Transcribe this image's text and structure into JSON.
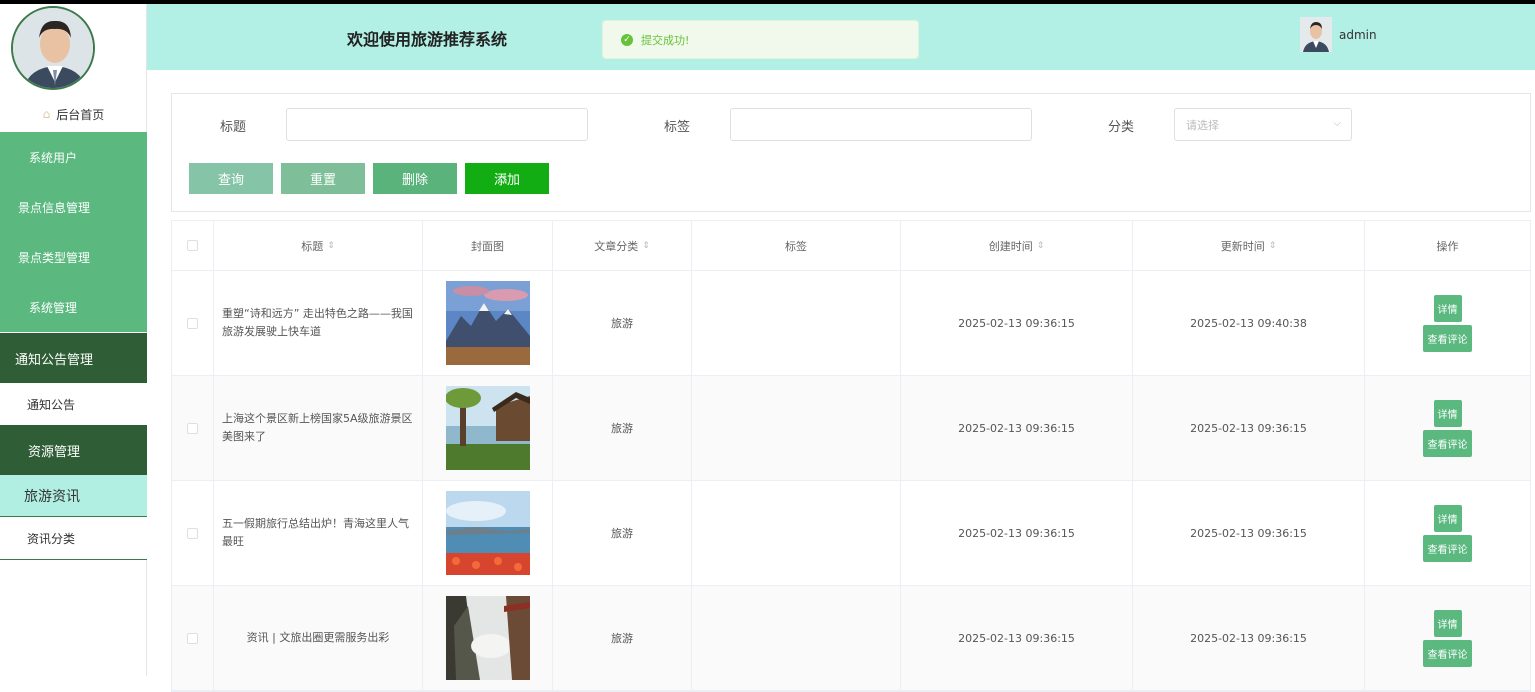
{
  "colors": {
    "sidebar_green": "#5bb980",
    "sidebar_dark": "#2f5d35",
    "header_bg": "#b2f0e5",
    "btn_query": "#85c4a6",
    "btn_reset": "#7ebf99",
    "btn_delete": "#5bb37c",
    "btn_add": "#12ad12"
  },
  "sidebar": {
    "home_label": "后台首页",
    "items": [
      {
        "label": "系统用户"
      },
      {
        "label": "景点信息管理"
      },
      {
        "label": "景点类型管理"
      },
      {
        "label": "系统管理"
      },
      {
        "label": "通知公告管理"
      },
      {
        "label": "通知公告"
      },
      {
        "label": "资源管理"
      },
      {
        "label": "旅游资讯"
      },
      {
        "label": "资讯分类"
      }
    ]
  },
  "header": {
    "title": "欢迎使用旅游推荐系统",
    "toast": "提交成功!",
    "user": "admin"
  },
  "search": {
    "title_label": "标题",
    "tag_label": "标签",
    "category_label": "分类",
    "category_placeholder": "请选择",
    "query_btn": "查询",
    "reset_btn": "重置",
    "delete_btn": "删除",
    "add_btn": "添加"
  },
  "table": {
    "headers": [
      "标题",
      "封面图",
      "文章分类",
      "标签",
      "创建时间",
      "更新时间",
      "操作"
    ],
    "rows": [
      {
        "title": "重塑“诗和远方” 走出特色之路——我国旅游发展驶上快车道",
        "category": "旅游",
        "tag": "",
        "created": "2025-02-13 09:36:15",
        "updated": "2025-02-13 09:40:38"
      },
      {
        "title": "上海这个景区新上榜国家5A级旅游景区 美图来了",
        "category": "旅游",
        "tag": "",
        "created": "2025-02-13 09:36:15",
        "updated": "2025-02-13 09:36:15"
      },
      {
        "title": "五一假期旅行总结出炉！青海这里人气最旺",
        "category": "旅游",
        "tag": "",
        "created": "2025-02-13 09:36:15",
        "updated": "2025-02-13 09:36:15"
      },
      {
        "title": "资讯 | 文旅出圈更需服务出彩",
        "category": "旅游",
        "tag": "",
        "created": "2025-02-13 09:36:15",
        "updated": "2025-02-13 09:36:15"
      }
    ],
    "detail_btn": "详情",
    "comment_btn": "查看评论"
  }
}
